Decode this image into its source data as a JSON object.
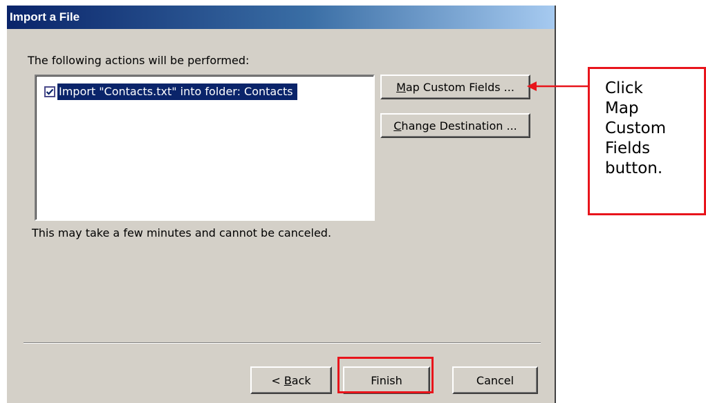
{
  "dialog": {
    "title": "Import a File",
    "actions_label": "The following actions will be performed:",
    "list_items": [
      {
        "checked": true,
        "text": "Import \"Contacts.txt\" into folder: Contacts"
      }
    ],
    "map_button": {
      "mnemonic": "M",
      "rest": "ap Custom Fields ..."
    },
    "change_button": {
      "mnemonic": "C",
      "rest": "hange Destination ..."
    },
    "note": "This may take a few minutes and cannot be canceled.",
    "back_button": {
      "prefix": "< ",
      "mnemonic": "B",
      "rest": "ack"
    },
    "finish_button": "Finish",
    "cancel_button": "Cancel"
  },
  "annotation": {
    "callout_lines": [
      "Click",
      "Map",
      "Custom",
      "Fields",
      "button."
    ],
    "highlight_color": "#e8141b"
  },
  "colors": {
    "title_bar": "#0a246a",
    "dialog_face": "#d4d0c8",
    "selection": "#0a246a"
  }
}
